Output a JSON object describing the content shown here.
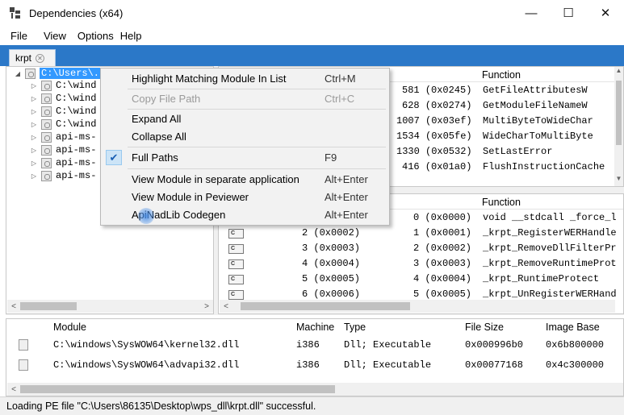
{
  "window": {
    "title": "Dependencies (x64)",
    "minimize": "—",
    "maximize": "☐",
    "close": "✕"
  },
  "menubar": {
    "file": "File",
    "view": "View",
    "options": "Options",
    "help": "Help"
  },
  "tab": {
    "label": "krpt",
    "close": "✕"
  },
  "tree": {
    "root": "C:\\Users\\...",
    "children": [
      "C:\\wind",
      "C:\\wind",
      "C:\\wind",
      "C:\\wind",
      "api-ms-",
      "api-ms-",
      "api-ms-",
      "api-ms-"
    ]
  },
  "imports": {
    "header_function": "Function",
    "rows": [
      {
        "ordinal": "581 (0x0245)",
        "function": "GetFileAttributesW"
      },
      {
        "ordinal": "628 (0x0274)",
        "function": "GetModuleFileNameW"
      },
      {
        "ordinal": "1007 (0x03ef)",
        "function": "MultiByteToWideChar"
      },
      {
        "ordinal": "1534 (0x05fe)",
        "function": "WideCharToMultiByte"
      },
      {
        "ordinal": "1330 (0x0532)",
        "function": "SetLastError"
      },
      {
        "ordinal": "416 (0x01a0)",
        "function": "FlushInstructionCache"
      }
    ]
  },
  "exports": {
    "header_function": "Function",
    "rows": [
      {
        "icon": "C",
        "ord": "",
        "hint": "0 (0x0000)",
        "function": "void __stdcall _force_l"
      },
      {
        "icon": "C",
        "ord": "2 (0x0002)",
        "hint": "1 (0x0001)",
        "function": "_krpt_RegisterWERHandle"
      },
      {
        "icon": "C",
        "ord": "3 (0x0003)",
        "hint": "2 (0x0002)",
        "function": "_krpt_RemoveDllFilterPr"
      },
      {
        "icon": "C",
        "ord": "4 (0x0004)",
        "hint": "3 (0x0003)",
        "function": "_krpt_RemoveRuntimeProt"
      },
      {
        "icon": "C",
        "ord": "5 (0x0005)",
        "hint": "4 (0x0004)",
        "function": "_krpt_RuntimeProtect"
      },
      {
        "icon": "C",
        "ord": "6 (0x0006)",
        "hint": "5 (0x0005)",
        "function": "_krpt_UnRegisterWERHand"
      }
    ]
  },
  "modules": {
    "headers": {
      "module": "Module",
      "machine": "Machine",
      "type": "Type",
      "file_size": "File Size",
      "image_base": "Image Base"
    },
    "rows": [
      {
        "module": "C:\\windows\\SysWOW64\\kernel32.dll",
        "machine": "i386",
        "type": "Dll; Executable",
        "file_size": "0x000996b0",
        "image_base": "0x6b800000"
      },
      {
        "module": "C:\\windows\\SysWOW64\\advapi32.dll",
        "machine": "i386",
        "type": "Dll; Executable",
        "file_size": "0x00077168",
        "image_base": "0x4c300000"
      }
    ]
  },
  "status": {
    "text": "Loading PE file \"C:\\Users\\86135\\Desktop\\wps_dll\\krpt.dll\" successful."
  },
  "context_menu": {
    "items": [
      {
        "label": "Highlight Matching Module In List",
        "shortcut": "Ctrl+M",
        "enabled": true
      },
      {
        "label": "Copy File Path",
        "shortcut": "Ctrl+C",
        "enabled": false
      },
      {
        "label": "Expand All",
        "shortcut": "",
        "enabled": true
      },
      {
        "label": "Collapse All",
        "shortcut": "",
        "enabled": true
      },
      {
        "label": "Full Paths",
        "shortcut": "F9",
        "enabled": true,
        "checked": true
      },
      {
        "label": "View Module in separate application",
        "shortcut": "Alt+Enter",
        "enabled": true
      },
      {
        "label": "View Module in Peviewer",
        "shortcut": "Alt+Enter",
        "enabled": true
      },
      {
        "label": "ApiNadLib Codegen",
        "shortcut": "Alt+Enter",
        "enabled": true
      }
    ]
  },
  "colors": {
    "tab_strip": "#2b78c8",
    "selection": "#3399ff"
  }
}
